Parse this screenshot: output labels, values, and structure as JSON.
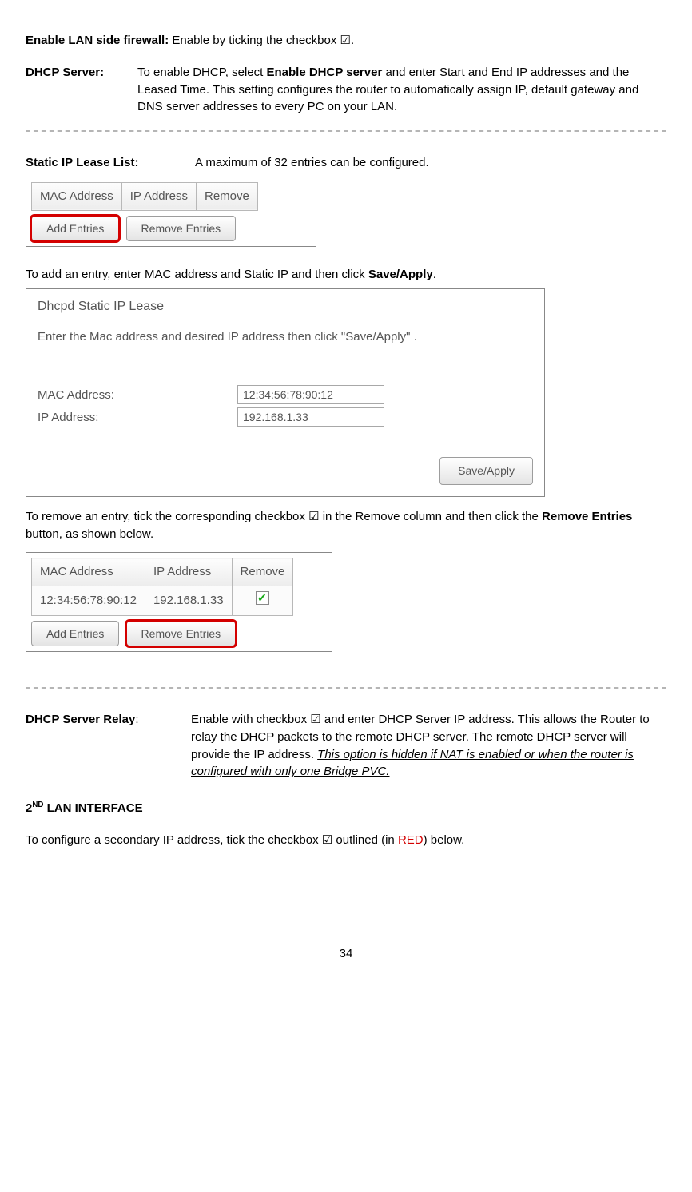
{
  "intro": {
    "firewall_label": "Enable LAN side firewall:",
    "firewall_text_a": " Enable by ticking the checkbox ",
    "checkbox_glyph": "☑",
    "period": "."
  },
  "dhcp": {
    "label": "DHCP Server:",
    "text_a": "To enable DHCP, select ",
    "text_bold": "Enable DHCP server",
    "text_b": " and enter Start and End IP addresses and the Leased Time. This setting configures the router to automatically assign IP, default gateway and DNS server addresses to every PC on your LAN."
  },
  "static_list": {
    "label": "Static IP Lease List:",
    "text": "A maximum of 32 entries can be configured."
  },
  "table1": {
    "h1": "MAC Address",
    "h2": "IP Address",
    "h3": "Remove",
    "add_btn": "Add Entries",
    "remove_btn": "Remove Entries"
  },
  "add_instruction": {
    "a": "To add an entry, enter MAC address and Static IP and then click ",
    "b": "Save/Apply",
    "c": "."
  },
  "dialog": {
    "title": "Dhcpd Static IP Lease",
    "desc": "Enter the Mac address and desired IP address then click \"Save/Apply\" .",
    "mac_label": "MAC Address:",
    "ip_label": "IP Address:",
    "mac_value": "12:34:56:78:90:12",
    "ip_value": "192.168.1.33",
    "save_btn": "Save/Apply"
  },
  "remove_instruction": {
    "a": "To remove an entry, tick the corresponding checkbox ",
    "b": " in the Remove column and then click the ",
    "c": "Remove Entries",
    "d": " button, as shown below."
  },
  "table2": {
    "h1": "MAC Address",
    "h2": "IP Address",
    "h3": "Remove",
    "mac": "12:34:56:78:90:12",
    "ip": "192.168.1.33",
    "add_btn": "Add Entries",
    "remove_btn": "Remove Entries"
  },
  "relay": {
    "label": "DHCP Server Relay",
    "colon": ":",
    "text_a": "Enable with checkbox ",
    "text_b": " and enter DHCP Server IP address. This allows the Router to relay the DHCP packets to the remote DHCP server. The remote DHCP server will provide the IP address. ",
    "text_ital": "This option is hidden if NAT is enabled or when the router is configured with only one Bridge PVC."
  },
  "second_lan": {
    "heading_a": "2",
    "heading_sup": "ND",
    "heading_b": " LAN INTERFACE",
    "text_a": "To configure a secondary IP address, tick the checkbox ",
    "text_b": " outlined (in ",
    "text_red": "RED",
    "text_c": ") below."
  },
  "page_number": "34"
}
